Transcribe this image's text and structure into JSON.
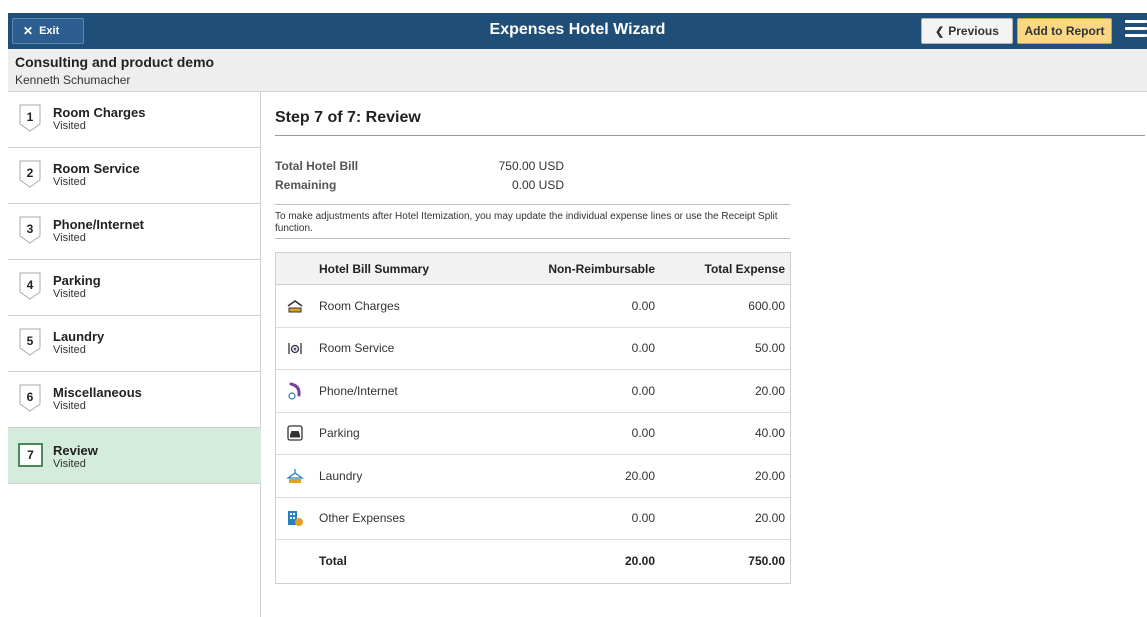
{
  "banner": {
    "exit_label": "Exit",
    "title": "Expenses Hotel Wizard",
    "previous_label": "Previous",
    "add_label": "Add to Report"
  },
  "header": {
    "title": "Consulting and product demo",
    "subtitle": "Kenneth Schumacher"
  },
  "steps": [
    {
      "num": "1",
      "title": "Room Charges",
      "status": "Visited"
    },
    {
      "num": "2",
      "title": "Room Service",
      "status": "Visited"
    },
    {
      "num": "3",
      "title": "Phone/Internet",
      "status": "Visited"
    },
    {
      "num": "4",
      "title": "Parking",
      "status": "Visited"
    },
    {
      "num": "5",
      "title": "Laundry",
      "status": "Visited"
    },
    {
      "num": "6",
      "title": "Miscellaneous",
      "status": "Visited"
    },
    {
      "num": "7",
      "title": "Review",
      "status": "Visited"
    }
  ],
  "main": {
    "heading": "Step 7 of 7: Review",
    "total_bill_label": "Total Hotel Bill",
    "total_bill_value": "750.00 USD",
    "remaining_label": "Remaining",
    "remaining_value": "0.00 USD",
    "note": "To make adjustments after Hotel Itemization, you may update the individual expense lines or use the Receipt Split function."
  },
  "summary": {
    "headers": {
      "name": "Hotel Bill Summary",
      "non_reimb": "Non-Reimbursable",
      "total": "Total Expense"
    },
    "rows": [
      {
        "icon": "bed-icon",
        "name": "Room Charges",
        "non_reimb": "0.00",
        "total": "600.00"
      },
      {
        "icon": "room-service-icon",
        "name": "Room Service",
        "non_reimb": "0.00",
        "total": "50.00"
      },
      {
        "icon": "phone-internet-icon",
        "name": "Phone/Internet",
        "non_reimb": "0.00",
        "total": "20.00"
      },
      {
        "icon": "car-icon",
        "name": "Parking",
        "non_reimb": "0.00",
        "total": "40.00"
      },
      {
        "icon": "hanger-icon",
        "name": "Laundry",
        "non_reimb": "20.00",
        "total": "20.00"
      },
      {
        "icon": "building-icon",
        "name": "Other Expenses",
        "non_reimb": "0.00",
        "total": "20.00"
      }
    ],
    "total_row": {
      "name": "Total",
      "non_reimb": "20.00",
      "total": "750.00"
    }
  }
}
